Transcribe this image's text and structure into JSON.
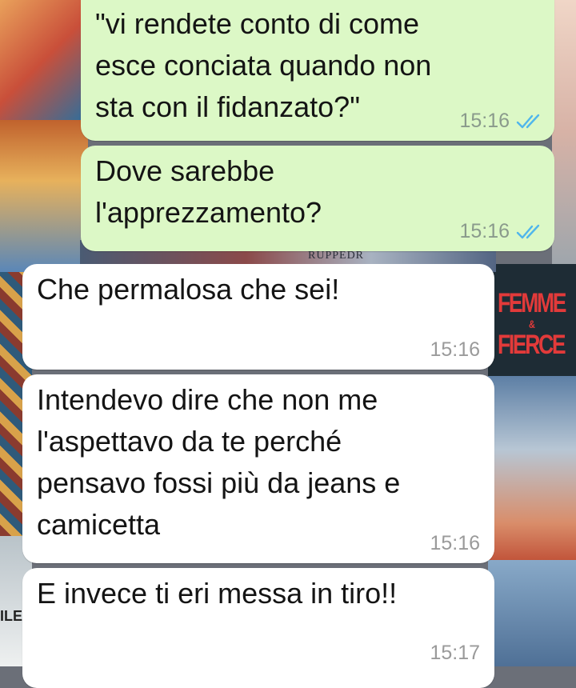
{
  "wallpaper": {
    "magazine_line1": "FEMME",
    "magazine_amp": "&",
    "magazine_line2": "FIERCE",
    "label": "RUPPEDR",
    "corner_text": "ILE"
  },
  "colors": {
    "outgoing_bubble": "#dcf8c6",
    "incoming_bubble": "#ffffff",
    "read_ticks": "#4fb6ec"
  },
  "messages": [
    {
      "direction": "outgoing",
      "text": "\"vi rendete conto di come\nesce conciata quando non\nsta con il fidanzato?\"",
      "time": "15:16",
      "status_icon": "double-check-read-icon"
    },
    {
      "direction": "outgoing",
      "text": "Dove sarebbe\nl'apprezzamento?",
      "time": "15:16",
      "status_icon": "double-check-read-icon"
    },
    {
      "direction": "incoming",
      "text": "Che permalosa che sei!",
      "time": "15:16"
    },
    {
      "direction": "incoming",
      "text": "Intendevo dire che non me\nl'aspettavo da te perché\npensavo fossi più da jeans e\ncamicetta",
      "time": "15:16"
    },
    {
      "direction": "incoming",
      "text": "E invece ti eri messa in tiro!!",
      "time": "15:17"
    }
  ]
}
